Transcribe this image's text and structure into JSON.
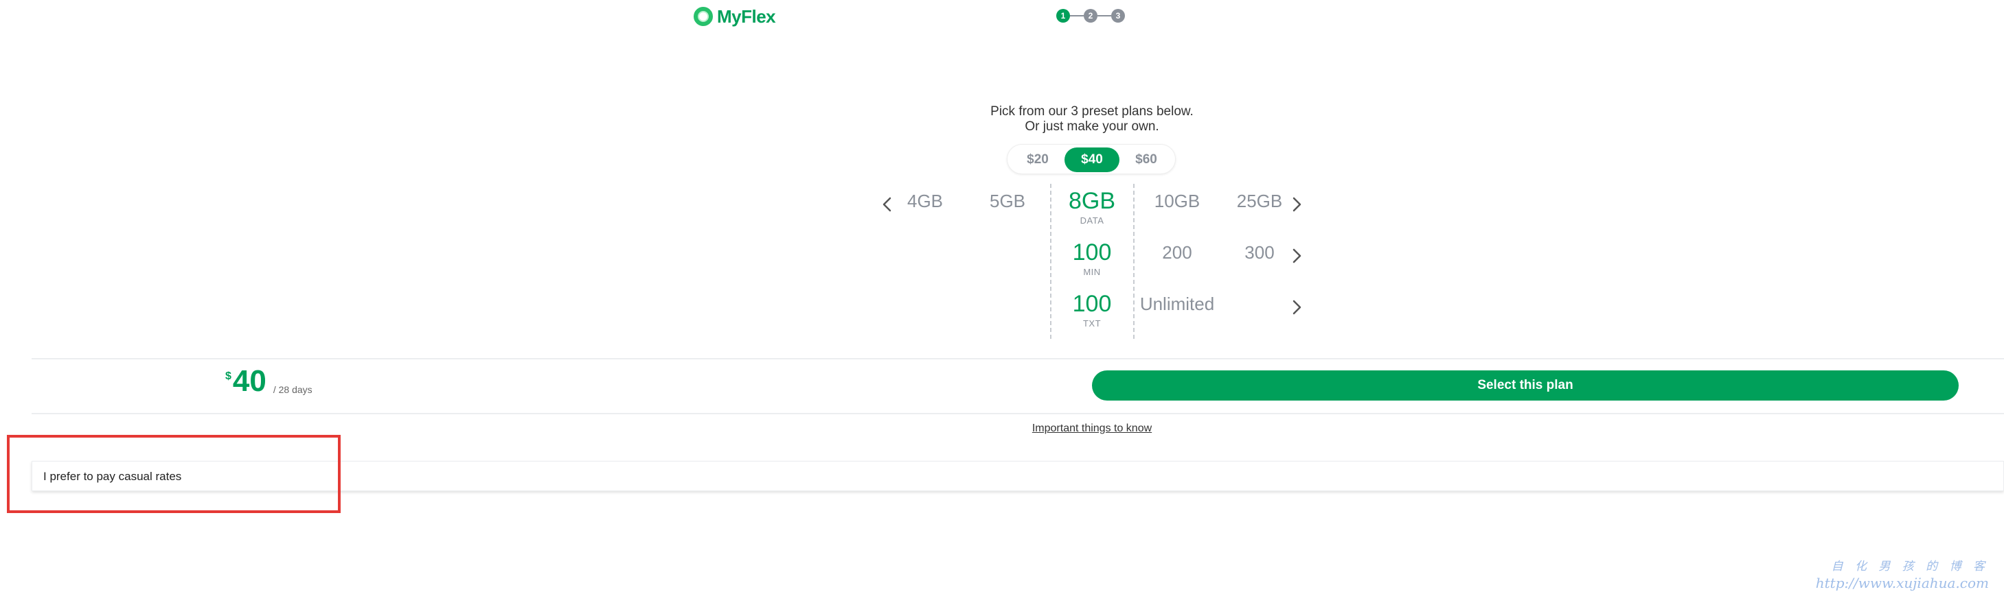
{
  "header": {
    "logo_text": "MyFlex",
    "steps": [
      "1",
      "2",
      "3"
    ],
    "active_step": 1
  },
  "intro": {
    "line1": "Pick from our 3 preset plans below.",
    "line2": "Or just make your own."
  },
  "price_options": {
    "opt1": "$20",
    "opt2": "$40",
    "opt3": "$60",
    "selected": "$40"
  },
  "data_row": {
    "options": [
      "4GB",
      "5GB",
      "8GB",
      "10GB",
      "25GB"
    ],
    "selected": "8GB",
    "unit": "DATA"
  },
  "min_row": {
    "options": [
      "100",
      "200",
      "300"
    ],
    "selected": "100",
    "unit": "MIN"
  },
  "txt_row": {
    "options": [
      "100",
      "Unlimited"
    ],
    "selected": "100",
    "unit": "TXT"
  },
  "summary": {
    "currency": "$",
    "amount": "40",
    "period": "/ 28 days",
    "select_label": "Select this plan"
  },
  "important_link": "Important things to know",
  "casual": {
    "label": "I prefer to pay casual rates"
  },
  "watermark": {
    "line1": "自 化 男 孩 的 博 客",
    "line2": "http://www.xujiahua.com"
  },
  "colors": {
    "brand_green": "#00a05a",
    "muted_gray": "#8a9099",
    "highlight_red": "#e53935"
  },
  "icons": {
    "prev": "chevron-left-icon",
    "next": "chevron-right-icon"
  }
}
